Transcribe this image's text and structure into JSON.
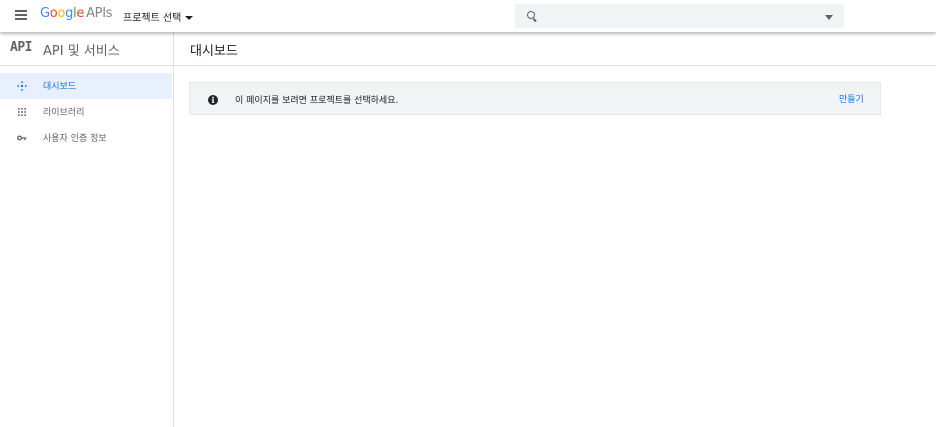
{
  "topbar": {
    "logo_google": [
      "G",
      "o",
      "o",
      "g",
      "l",
      "e"
    ],
    "logo_apis": "APIs",
    "project_select_label": "프로젝트 선택",
    "search_value": ""
  },
  "sidebar": {
    "badge": "API",
    "title": "API 및 서비스",
    "items": [
      {
        "label": "대시보드",
        "icon": "dashboard-icon",
        "active": true
      },
      {
        "label": "라이브러리",
        "icon": "library-icon",
        "active": false
      },
      {
        "label": "사용자 인증 정보",
        "icon": "key-icon",
        "active": false
      }
    ]
  },
  "main": {
    "title": "대시보드",
    "notice": {
      "text": "이 페이지를 보려면 프로젝트를 선택하세요.",
      "action": "만들기"
    }
  },
  "colors": {
    "accent": "#1a73e8",
    "active_bg": "#e8f0fe",
    "notice_bg": "#f1f3f4"
  }
}
